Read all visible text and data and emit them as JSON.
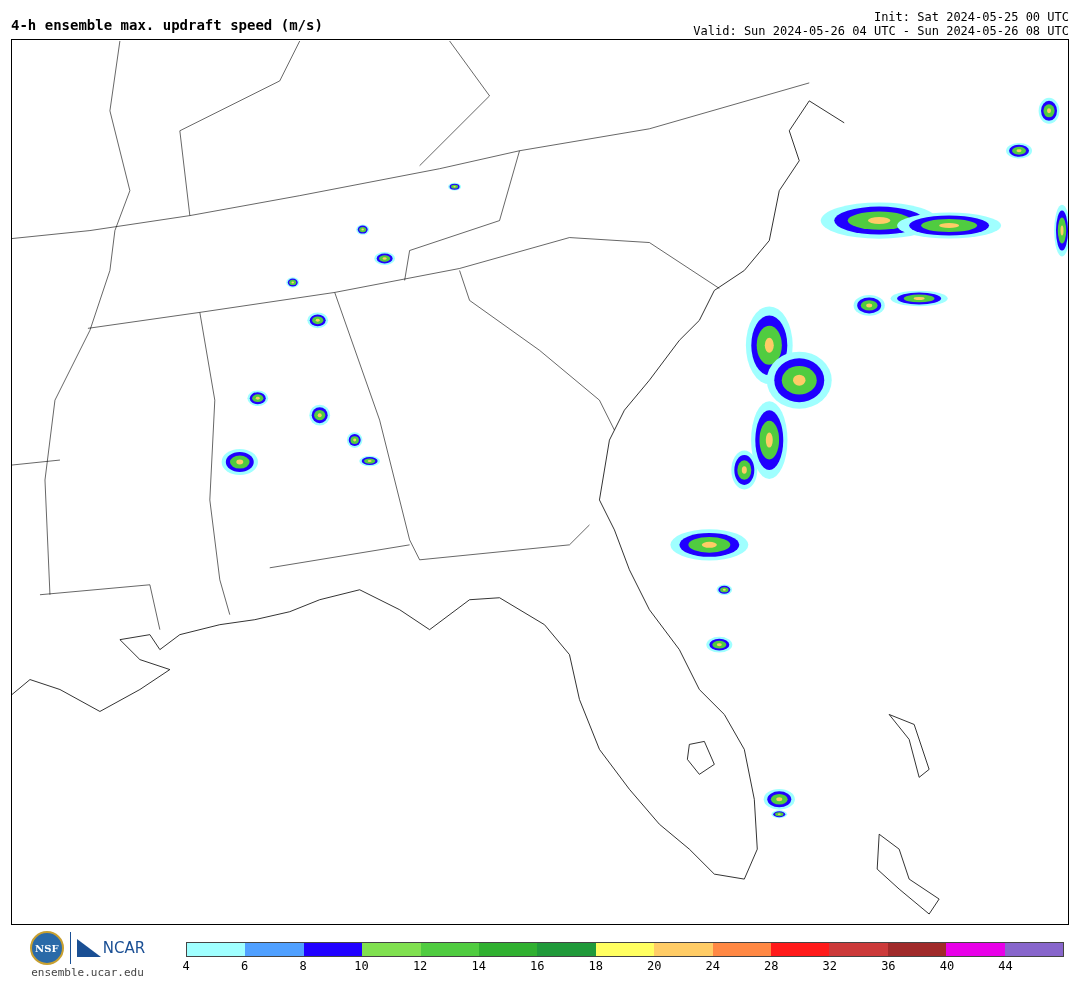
{
  "title": "4-h ensemble max. updraft speed (m/s)",
  "init": "Init: Sat 2024-05-25 00 UTC",
  "valid": "Valid: Sun 2024-05-26 04 UTC - Sun 2024-05-26 08 UTC",
  "logos": {
    "nsf": "NSF",
    "ncar": "NCAR",
    "site": "ensemble.ucar.edu"
  },
  "colorbar": {
    "bins": [
      {
        "color": "#a0ffff"
      },
      {
        "color": "#50a0ff"
      },
      {
        "color": "#2000ff"
      },
      {
        "color": "#80e050"
      },
      {
        "color": "#50cc40"
      },
      {
        "color": "#30b030"
      },
      {
        "color": "#209a3a"
      },
      {
        "color": "#ffff60"
      },
      {
        "color": "#ffcc66"
      },
      {
        "color": "#ff8844"
      },
      {
        "color": "#ff1a1a"
      },
      {
        "color": "#cc3a3a"
      },
      {
        "color": "#a02a2a"
      },
      {
        "color": "#e800e8"
      },
      {
        "color": "#8866cc"
      }
    ],
    "labels": [
      "4",
      "6",
      "8",
      "10",
      "12",
      "14",
      "16",
      "18",
      "20",
      "24",
      "28",
      "32",
      "36",
      "40",
      "44"
    ]
  }
}
